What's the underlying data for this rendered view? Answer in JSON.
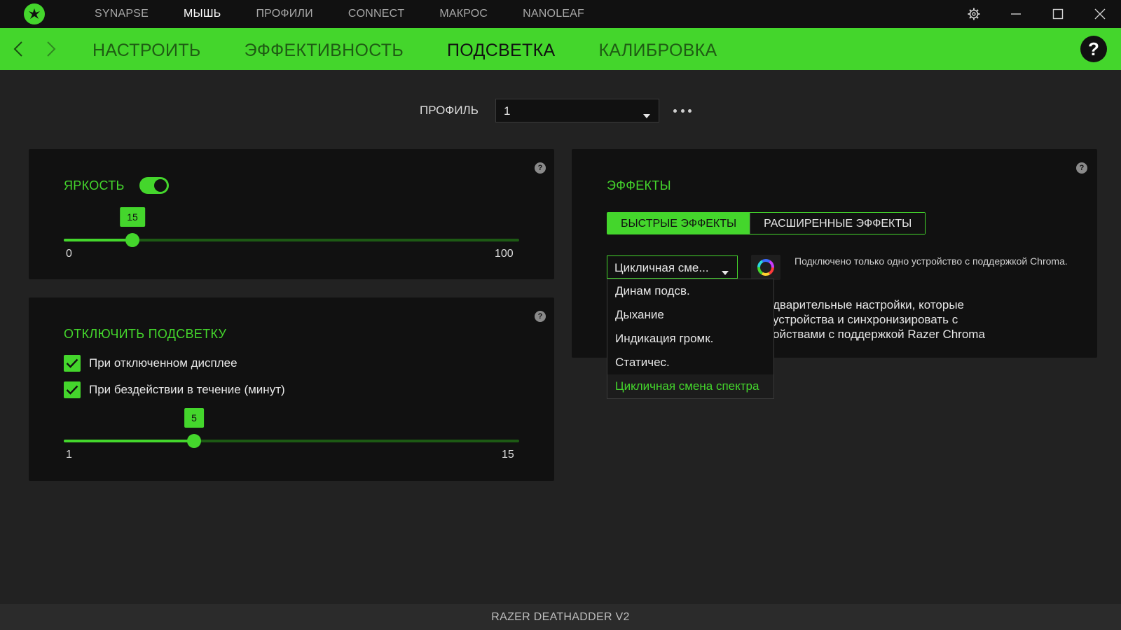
{
  "colors": {
    "accent": "#44d62c",
    "background": "#222222",
    "panel": "#111111"
  },
  "topnav": {
    "items": [
      "SYNAPSE",
      "МЫШЬ",
      "ПРОФИЛИ",
      "CONNECT",
      "МАКРОС",
      "NANOLEAF"
    ],
    "active_index": 1
  },
  "window_controls": {
    "icons": [
      "gear-icon",
      "minimize-icon",
      "maximize-icon",
      "close-icon"
    ]
  },
  "subnav": {
    "items": [
      "НАСТРОИТЬ",
      "ЭФФЕКТИВНОСТЬ",
      "ПОДСВЕТКА",
      "КАЛИБРОВКА"
    ],
    "active_index": 2,
    "help": "?"
  },
  "profile": {
    "label": "ПРОФИЛЬ",
    "value": "1"
  },
  "brightness": {
    "title": "ЯРКОСТЬ",
    "toggle_on": true,
    "value": "15",
    "min": "0",
    "max": "100",
    "fraction": 0.15
  },
  "lighting_off": {
    "title": "ОТКЛЮЧИТЬ ПОДСВЕТКУ",
    "options": [
      {
        "label": "При отключенном дисплее",
        "checked": true
      },
      {
        "label": "При бездействии в течение (минут)",
        "checked": true
      }
    ],
    "value": "5",
    "min": "1",
    "max": "15",
    "fraction": 0.2857
  },
  "effects": {
    "title": "ЭФФЕКТЫ",
    "tabs": [
      "БЫСТРЫЕ ЭФФЕКТЫ",
      "РАСШИРЕННЫЕ ЭФФЕКТЫ"
    ],
    "active_tab": 0,
    "selected": "Цикличная сме...",
    "chroma_note": "Подключено только одно устройство с поддержкой Chroma.",
    "description_lines": [
      "дварительные настройки, которые",
      "устройства и синхронизировать с",
      "ойствами с поддержкой Razer Chroma"
    ],
    "dropdown_options": [
      "Динам подсв.",
      "Дыхание",
      "Индикация громк.",
      "Статичес.",
      "Цикличная смена спектра"
    ],
    "dropdown_selected_index": 4
  },
  "help_mark": "?",
  "footer": {
    "device": "RAZER DEATHADDER V2"
  }
}
